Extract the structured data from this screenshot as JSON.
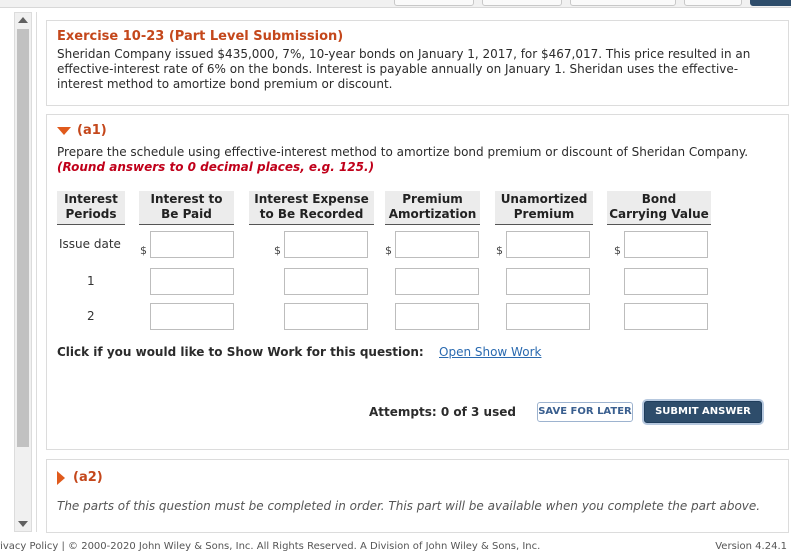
{
  "exercise": {
    "title": "Exercise 10-23 (Part Level Submission)",
    "description": "Sheridan Company issued $435,000, 7%, 10-year bonds on January 1, 2017, for $467,017. This price resulted in an effective-interest rate of 6% on the bonds. Interest is payable annually on January 1. Sheridan uses the effective-interest method to amortize bond premium or discount."
  },
  "part_a1": {
    "label": "(a1)",
    "instruction": "Prepare the schedule using effective-interest method to amortize bond premium or discount of Sheridan Company.",
    "rounding_note": "(Round answers to 0 decimal places, e.g. 125.)",
    "columns": [
      {
        "line1": "Interest",
        "line2": "Periods"
      },
      {
        "line1": "Interest to",
        "line2": "Be Paid"
      },
      {
        "line1": "Interest Expense",
        "line2": "to Be Recorded"
      },
      {
        "line1": "Premium",
        "line2": "Amortization"
      },
      {
        "line1": "Unamortized",
        "line2": "Premium"
      },
      {
        "line1": "Bond",
        "line2": "Carrying Value"
      }
    ],
    "rows": [
      {
        "label": "Issue date",
        "values": [
          "",
          "",
          "",
          "",
          ""
        ]
      },
      {
        "label": "1",
        "values": [
          "",
          "",
          "",
          "",
          ""
        ]
      },
      {
        "label": "2",
        "values": [
          "",
          "",
          "",
          "",
          ""
        ]
      }
    ],
    "currency_symbol": "$",
    "show_work_prompt": "Click if you would like to Show Work for this question:",
    "show_work_link": "Open Show Work",
    "attempts": "Attempts: 0 of 3 used",
    "save_label": "SAVE FOR LATER",
    "submit_label": "SUBMIT ANSWER"
  },
  "part_a2": {
    "label": "(a2)",
    "message": "The parts of this question must be completed in order. This part will be available when you complete the part above."
  },
  "footer": {
    "left": "rivacy Policy  |  © 2000-2020 John Wiley & Sons, Inc. All Rights Reserved. A Division of John Wiley & Sons, Inc.",
    "right": "Version 4.24.1"
  },
  "colors": {
    "accent_orange": "#c4471b",
    "rounding_red": "#c0001a",
    "submit_blue": "#2e4d6b",
    "link_blue": "#2a6ab0"
  }
}
